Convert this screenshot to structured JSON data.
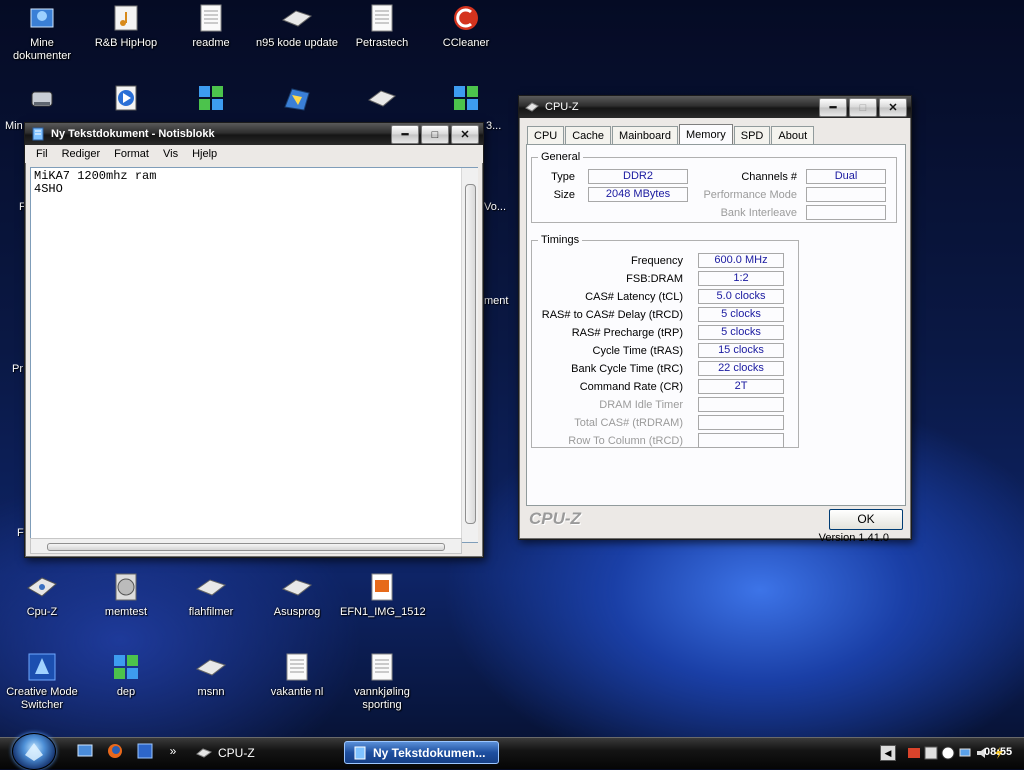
{
  "desktop": {
    "icons": [
      {
        "label": "Mine\ndokumenter",
        "icon": "my-documents-icon"
      },
      {
        "label": "R&B HipHop",
        "icon": "music-folder-icon"
      },
      {
        "label": "readme",
        "icon": "text-file-icon"
      },
      {
        "label": "n95 kode update",
        "icon": "shortcut-icon"
      },
      {
        "label": "Petrastech",
        "icon": "text-file-icon"
      },
      {
        "label": "CCleaner",
        "icon": "ccleaner-icon"
      },
      {
        "label": "Cpu-Z",
        "icon": "cpuz-icon"
      },
      {
        "label": "memtest",
        "icon": "memtest-icon"
      },
      {
        "label": "flahfilmer",
        "icon": "shortcut-icon"
      },
      {
        "label": "Asusprog",
        "icon": "shortcut-icon"
      },
      {
        "label": "EFN1_IMG_1512",
        "icon": "image-file-icon"
      },
      {
        "label": "Creative Mode\nSwitcher",
        "icon": "creative-icon"
      },
      {
        "label": "dep",
        "icon": "windows-icon"
      },
      {
        "label": "msnn",
        "icon": "shortcut-icon"
      },
      {
        "label": "vakantie nl",
        "icon": "text-file-icon"
      },
      {
        "label": "vannkjøling\nsporting",
        "icon": "text-file-icon"
      }
    ],
    "partial_labels": [
      "Min",
      "F",
      "Pr",
      "F",
      "3...",
      "Vo...",
      "ment"
    ]
  },
  "notepad": {
    "title": "Ny Tekstdokument - Notisblokk",
    "menu": [
      "Fil",
      "Rediger",
      "Format",
      "Vis",
      "Hjelp"
    ],
    "content_line1": "MiKA7 1200mhz ram",
    "content_line2": "4SHO"
  },
  "cpuz": {
    "title": "CPU-Z",
    "tabs": [
      "CPU",
      "Cache",
      "Mainboard",
      "Memory",
      "SPD",
      "About"
    ],
    "active_tab": "Memory",
    "general": {
      "legend": "General",
      "type_label": "Type",
      "type_value": "DDR2",
      "size_label": "Size",
      "size_value": "2048 MBytes",
      "channels_label": "Channels #",
      "channels_value": "Dual",
      "perf_label": "Performance Mode",
      "perf_value": "",
      "bank_label": "Bank Interleave",
      "bank_value": ""
    },
    "timings": {
      "legend": "Timings",
      "rows": [
        {
          "label": "Frequency",
          "value": "600.0 MHz",
          "enabled": true
        },
        {
          "label": "FSB:DRAM",
          "value": "1:2",
          "enabled": true
        },
        {
          "label": "CAS# Latency (tCL)",
          "value": "5.0 clocks",
          "enabled": true
        },
        {
          "label": "RAS# to CAS# Delay (tRCD)",
          "value": "5 clocks",
          "enabled": true
        },
        {
          "label": "RAS# Precharge (tRP)",
          "value": "5 clocks",
          "enabled": true
        },
        {
          "label": "Cycle Time (tRAS)",
          "value": "15 clocks",
          "enabled": true
        },
        {
          "label": "Bank Cycle Time (tRC)",
          "value": "22 clocks",
          "enabled": true
        },
        {
          "label": "Command Rate (CR)",
          "value": "2T",
          "enabled": true
        },
        {
          "label": "DRAM Idle Timer",
          "value": "",
          "enabled": false
        },
        {
          "label": "Total CAS# (tRDRAM)",
          "value": "",
          "enabled": false
        },
        {
          "label": "Row To Column (tRCD)",
          "value": "",
          "enabled": false
        }
      ]
    },
    "version": "Version 1.41.0",
    "brand": "CPU-Z",
    "ok_label": "OK"
  },
  "taskbar": {
    "tasks": [
      {
        "label": "CPU-Z",
        "active": false
      },
      {
        "label": "Ny Tekstdokumen...",
        "active": true
      }
    ],
    "clock": "08:55",
    "overflow": "»"
  }
}
